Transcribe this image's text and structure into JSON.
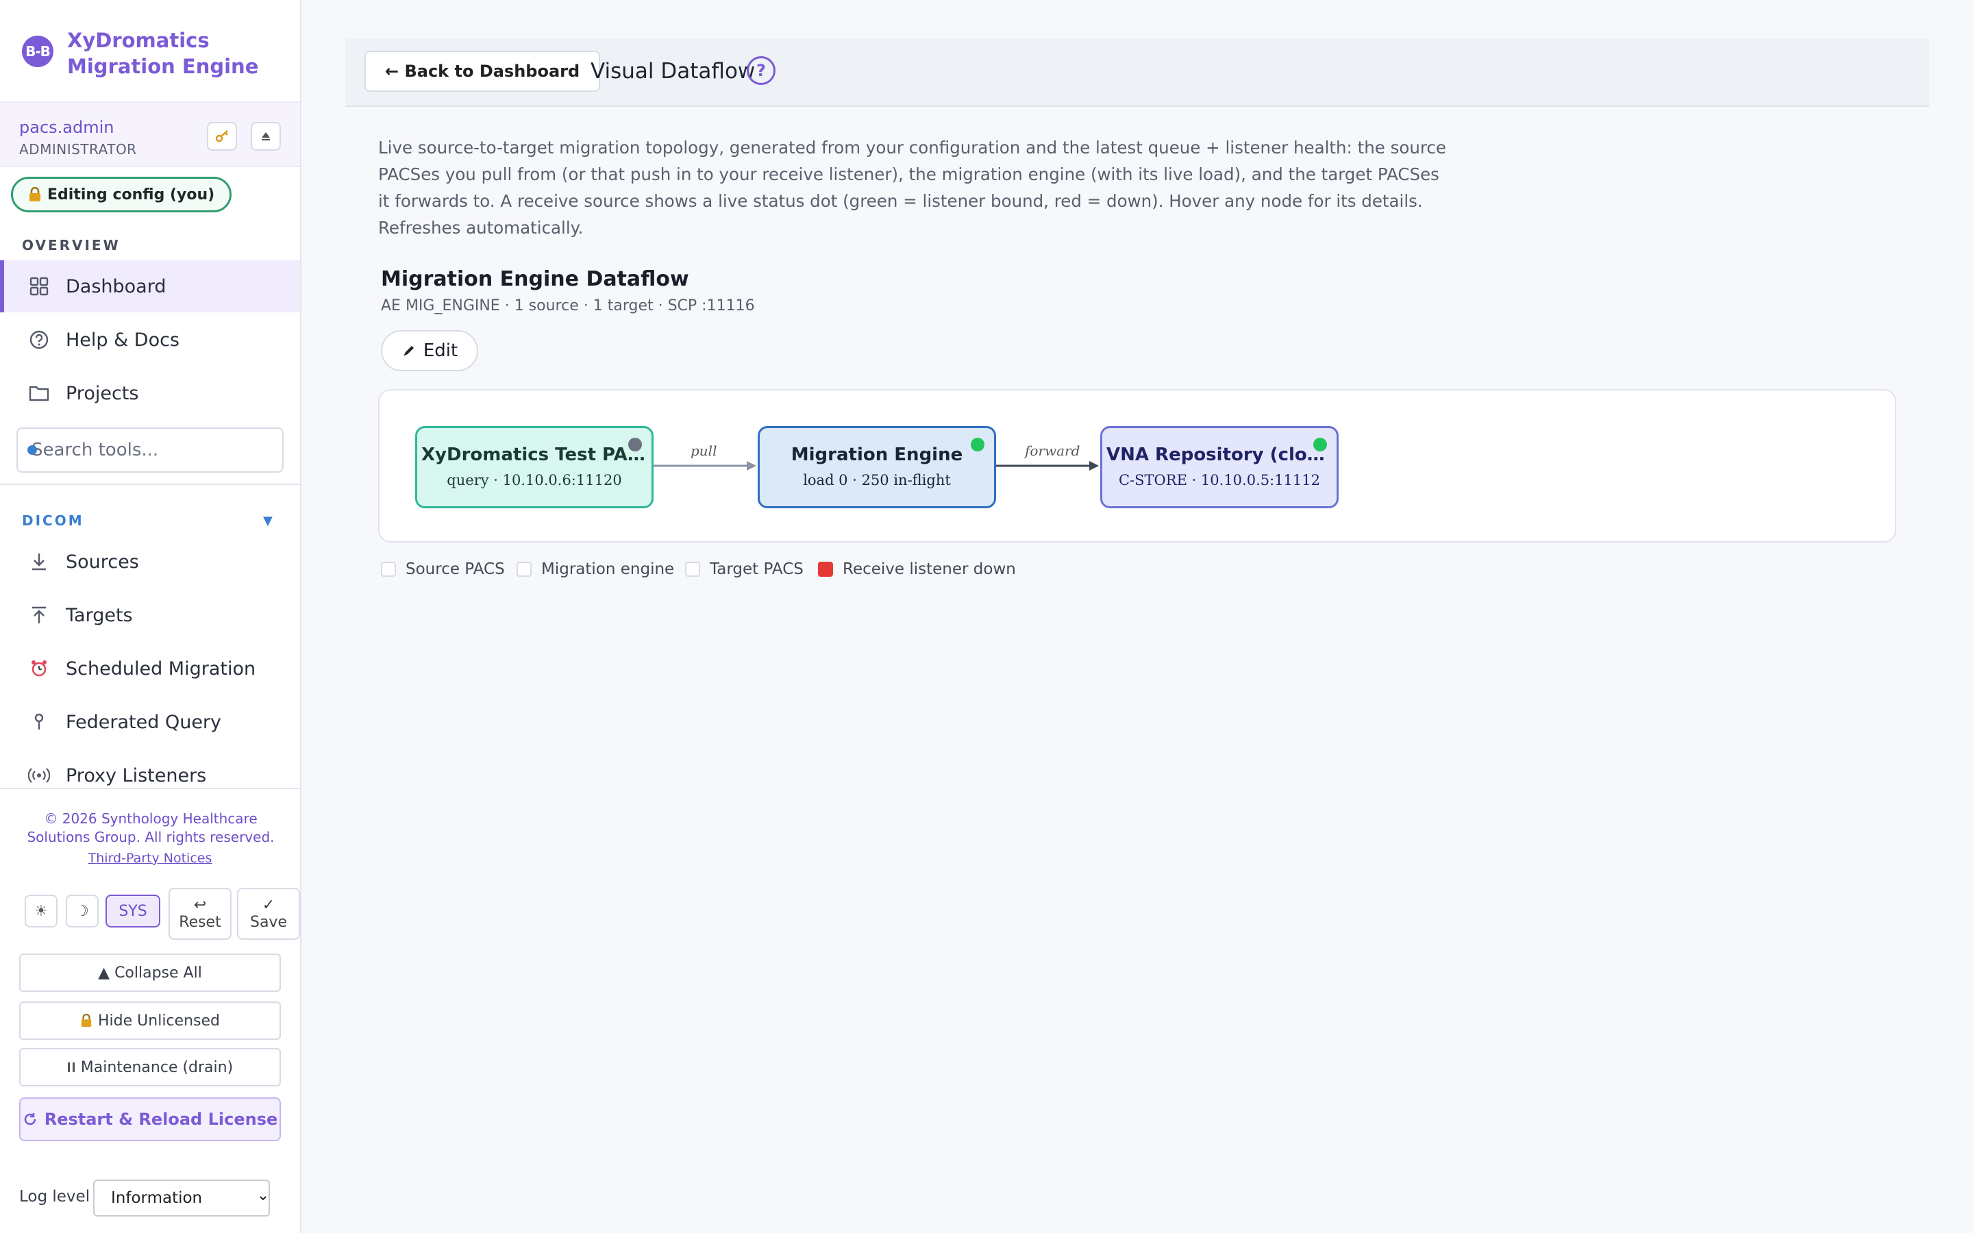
{
  "brand": {
    "logo_glyph": "B-B",
    "name_line1": "XyDromatics",
    "name_line2": "Migration Engine",
    "accent": "#7b5bd6"
  },
  "user": {
    "name": "pacs.admin",
    "role": "ADMINISTRATOR"
  },
  "lock_status": "Editing config (you)",
  "overview": {
    "label": "OVERVIEW",
    "items": [
      {
        "label": "Dashboard",
        "icon": "grid-icon",
        "active": true
      },
      {
        "label": "Help & Docs",
        "icon": "help-icon"
      },
      {
        "label": "Projects",
        "icon": "folder-icon"
      }
    ]
  },
  "search": {
    "placeholder": "Search tools..."
  },
  "dicom": {
    "label": "DICOM",
    "items": [
      {
        "label": "Sources",
        "icon": "download-icon"
      },
      {
        "label": "Targets",
        "icon": "upload-icon"
      },
      {
        "label": "Scheduled Migration",
        "icon": "alarm-clock-icon"
      },
      {
        "label": "Federated Query",
        "icon": "pin-icon"
      },
      {
        "label": "Proxy Listeners",
        "icon": "broadcast-icon"
      }
    ]
  },
  "footer": {
    "copyright": "© 2026 Synthology Healthcare Solutions Group. All rights reserved.",
    "third_party": "Third-Party Notices",
    "theme": {
      "light": "☀",
      "dark": "☽",
      "sys": "SYS"
    },
    "reset": {
      "glyph": "↩",
      "label": "Reset"
    },
    "save": {
      "glyph": "✓",
      "label": "Save"
    },
    "collapse_all": "▲ Collapse All",
    "hide_unlicensed": "Hide Unlicensed",
    "maintenance": "Maintenance (drain)",
    "restart": "Restart & Reload License",
    "log_level_label": "Log level",
    "log_level_value": "Information"
  },
  "header": {
    "back_label": "← Back to Dashboard",
    "title": "Visual Dataflow",
    "help_glyph": "?"
  },
  "description": "Live source-to-target migration topology, generated from your configuration and the latest queue + listener health: the source PACSes you pull from (or that push in to your receive listener), the migration engine (with its live load), and the target PACSes it forwards to. A receive source shows a live status dot (green = listener bound, red = down). Hover any node for its details. Refreshes automatically.",
  "dataflow": {
    "title": "Migration Engine Dataflow",
    "subtitle": "AE MIG_ENGINE · 1 source · 1 target · SCP :11116",
    "edit_label": "Edit",
    "nodes": [
      {
        "title": "XyDromatics Test PACS",
        "sub": "query · 10.10.0.6:11120",
        "fill": "#d8f7ee",
        "border": "#2fb89a",
        "text": "#1a3a34",
        "dot": "#6b7280"
      },
      {
        "title": "Migration Engine",
        "sub": "load 0 · 250 in-flight",
        "fill": "#dbe9f8",
        "border": "#2f6fbf",
        "text": "#1a2433",
        "dot": "#22c55e"
      },
      {
        "title": "VNA Repository (cloud d...",
        "sub": "C-STORE · 10.10.0.5:11112",
        "fill": "#e4e6fb",
        "border": "#6a72d6",
        "text": "#1f2366",
        "dot": "#22c55e"
      }
    ],
    "edges": [
      {
        "label": "pull",
        "color": "#8a94a8"
      },
      {
        "label": "forward",
        "color": "#3f4656"
      }
    ],
    "legend": [
      {
        "label": "Source PACS",
        "swatch": "empty"
      },
      {
        "label": "Migration engine",
        "swatch": "empty"
      },
      {
        "label": "Target PACS",
        "swatch": "empty"
      },
      {
        "label": "Receive listener down",
        "swatch": "down"
      }
    ]
  }
}
